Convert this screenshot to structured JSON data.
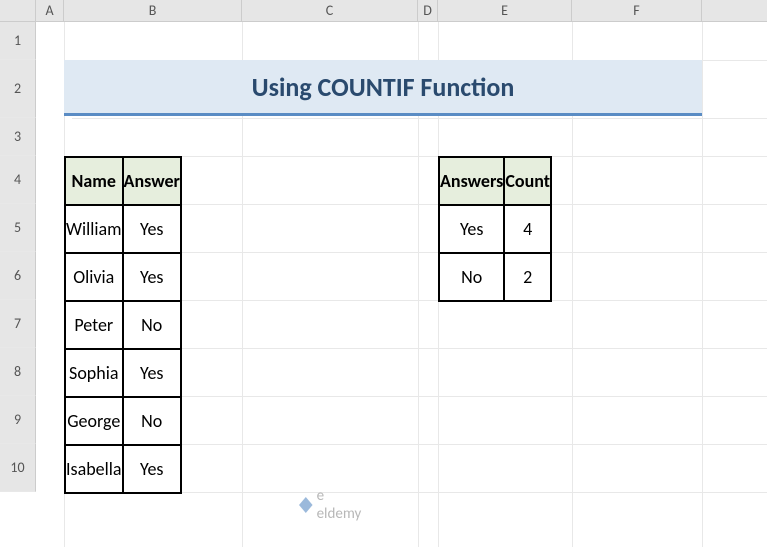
{
  "columns": [
    "A",
    "B",
    "C",
    "D",
    "E",
    "F"
  ],
  "rows": [
    "1",
    "2",
    "3",
    "4",
    "5",
    "6",
    "7",
    "8",
    "9",
    "10"
  ],
  "title": "Using COUNTIF Function",
  "table1": {
    "headers": [
      "Name",
      "Answer"
    ],
    "rows": [
      {
        "name": "William",
        "answer": "Yes"
      },
      {
        "name": "Olivia",
        "answer": "Yes"
      },
      {
        "name": "Peter",
        "answer": "No"
      },
      {
        "name": "Sophia",
        "answer": "Yes"
      },
      {
        "name": "George",
        "answer": "No"
      },
      {
        "name": "Isabella",
        "answer": "Yes"
      }
    ]
  },
  "table2": {
    "headers": [
      "Answers",
      "Count"
    ],
    "rows": [
      {
        "answer": "Yes",
        "count": "4"
      },
      {
        "answer": "No",
        "count": "2"
      }
    ]
  },
  "watermark": "e    eldemy"
}
